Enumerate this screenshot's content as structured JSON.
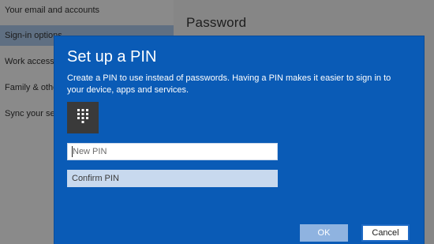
{
  "sidebar": {
    "items": [
      {
        "label": "Your email and accounts"
      },
      {
        "label": "Sign-in options",
        "selected": true
      },
      {
        "label": "Work access"
      },
      {
        "label": "Family & other users"
      },
      {
        "label": "Sync your settings"
      }
    ]
  },
  "main": {
    "section_title": "Password"
  },
  "dialog": {
    "title": "Set up a PIN",
    "description": "Create a PIN to use instead of passwords. Having a PIN makes it easier to sign in to your device, apps and services.",
    "icon": "keypad-icon",
    "new_pin": {
      "value": "",
      "placeholder": "New PIN"
    },
    "confirm_pin": {
      "value": "",
      "placeholder": "Confirm PIN"
    },
    "ok_label": "OK",
    "cancel_label": "Cancel"
  },
  "colors": {
    "dialog_bg": "#0a5bb6",
    "ok_button_bg": "#8fb3e0",
    "cancel_border": "#1f6ac4",
    "keypad_tile_bg": "#3a3a3a"
  }
}
